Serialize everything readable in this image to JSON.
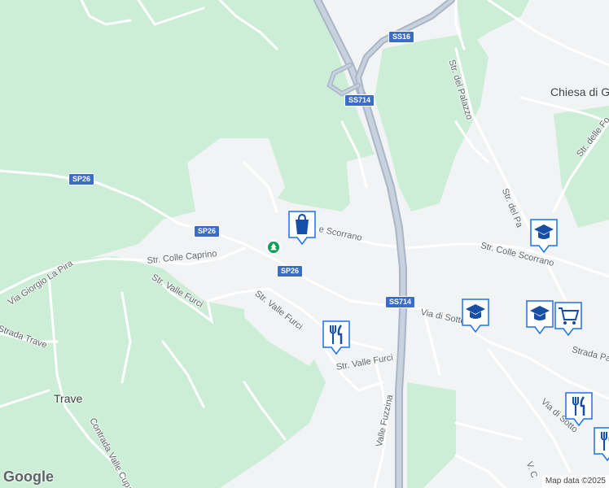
{
  "map": {
    "places": [
      {
        "id": "chiesa",
        "text": "Chiesa di Go"
      },
      {
        "id": "trave",
        "text": "Trave"
      }
    ],
    "streets": [
      {
        "id": "str-del-palazzo-top",
        "text": "Str. del Palazzo"
      },
      {
        "id": "str-delle-fo",
        "text": "Str. delle Fo"
      },
      {
        "id": "str-del-pa",
        "text": "Str. del Pa"
      },
      {
        "id": "scorrano",
        "text": "e Scorrano"
      },
      {
        "id": "colle-scorrano",
        "text": "Str. Colle Scorrano"
      },
      {
        "id": "colle-caprino",
        "text": "Str. Colle Caprino"
      },
      {
        "id": "valle-furci-1",
        "text": "Str. Valle Furci"
      },
      {
        "id": "valle-furci-2",
        "text": "Str. Valle Furci"
      },
      {
        "id": "valle-furci-3",
        "text": "Str. Valle Furci"
      },
      {
        "id": "via-giorgio",
        "text": "Via Giorgio La Pira"
      },
      {
        "id": "strada-trave",
        "text": "Strada Trave"
      },
      {
        "id": "contrada-valle",
        "text": "Contrada Valle Cupa"
      },
      {
        "id": "via-di-sotto-1",
        "text": "Via di Sotto"
      },
      {
        "id": "via-di-sotto-2",
        "text": "Via di Sotto"
      },
      {
        "id": "strada-pa",
        "text": "Strada Pa"
      },
      {
        "id": "valle-fuzzina",
        "text": "Valle Fuzzina"
      },
      {
        "id": "v-c",
        "text": "V. C"
      }
    ],
    "shields": [
      {
        "id": "ss16",
        "text": "SS16"
      },
      {
        "id": "ss714-top",
        "text": "SS714"
      },
      {
        "id": "sp26-left",
        "text": "SP26"
      },
      {
        "id": "sp26-mid",
        "text": "SP26"
      },
      {
        "id": "sp26-bottom",
        "text": "SP26"
      },
      {
        "id": "ss714-mid",
        "text": "SS714"
      }
    ],
    "pins": [
      {
        "id": "shopping",
        "icon": "shopping-bag-icon"
      },
      {
        "id": "school-1",
        "icon": "school-icon"
      },
      {
        "id": "school-2",
        "icon": "school-icon"
      },
      {
        "id": "school-3",
        "icon": "school-icon"
      },
      {
        "id": "grocery",
        "icon": "shopping-cart-icon"
      },
      {
        "id": "restaurant-1",
        "icon": "restaurant-icon"
      },
      {
        "id": "restaurant-2",
        "icon": "restaurant-icon"
      },
      {
        "id": "restaurant-3",
        "icon": "restaurant-icon"
      },
      {
        "id": "park",
        "icon": "park-icon"
      }
    ],
    "logo": "Google",
    "attribution": "Map data ©2025"
  },
  "colors": {
    "green_area": "#cdeed6",
    "land": "#f1f3f4",
    "road": "#ffffff",
    "highway": "#a8b6c8",
    "pin_blue": "#1a73e8",
    "shield_blue": "#3b6dc6"
  }
}
